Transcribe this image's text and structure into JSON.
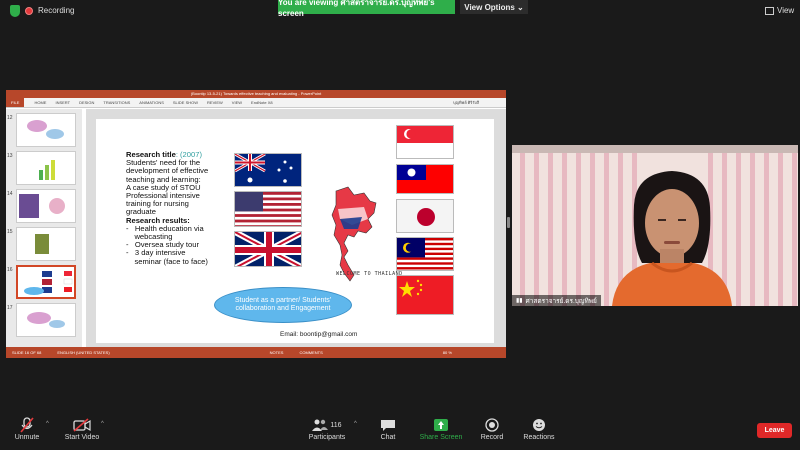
{
  "top": {
    "recording": "Recording",
    "banner": "You are viewing ศาสตราจารย์.ดร.บุญทิพย์'s screen",
    "view_options": "View Options",
    "view": "View"
  },
  "ppt": {
    "title": "(Boontip 13-5-21) Towards effective teaching and evaluating - PowerPoint",
    "tabs": [
      "FILE",
      "HOME",
      "INSERT",
      "DESIGN",
      "TRANSITIONS",
      "ANIMATIONS",
      "SLIDE SHOW",
      "REVIEW",
      "VIEW",
      "EndNote X8"
    ],
    "user": "บุญทิพย์ ศิริรังสี",
    "thumb_numbers": [
      "12",
      "13",
      "14",
      "15",
      "16",
      "17"
    ],
    "status": "SLIDE 16 OF 68",
    "language": "ENGLISH (UNITED STATES)",
    "notes": "NOTES",
    "comments": "COMMENTS",
    "zoom": "80 %"
  },
  "slide": {
    "research_title_label": "Research title",
    "research_year": ": (2007)",
    "title_lines": [
      "Students' need for the",
      "development of effective",
      "teaching and learning:",
      "A case study of STOU",
      "Professional intensive",
      "training for nursing",
      "graduate"
    ],
    "results_label": "Research results:",
    "results": [
      "-   Health education via",
      "    webcasting",
      "-   Oversea study tour",
      "-   3 day intensive",
      "    seminar (face to face)"
    ],
    "ellipse_text": "Student as a partner/ Students' collaboration and Engagement",
    "email": "Email: boontip@gmail.com",
    "map_caption": "WELCOME TO THAILAND"
  },
  "video": {
    "name": "ศาสตราจารย์.ดร.บุญทิพย์"
  },
  "toolbar": {
    "unmute": "Unmute",
    "start_video": "Start Video",
    "participants": "Participants",
    "participant_count": "116",
    "chat": "Chat",
    "share_screen": "Share Screen",
    "record": "Record",
    "reactions": "Reactions",
    "leave": "Leave"
  },
  "colors": {
    "zoom_green": "#2fae4a",
    "ppt_red": "#b7472a",
    "leave_red": "#e02828"
  }
}
